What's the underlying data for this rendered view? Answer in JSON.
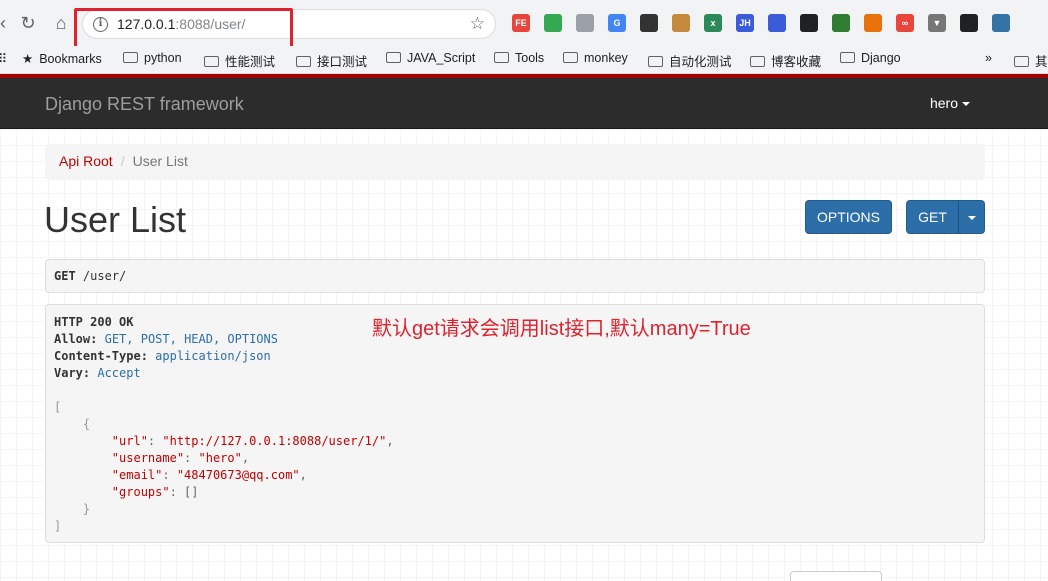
{
  "browser": {
    "url_host": "127.0.0.1",
    "url_rest": ":8088/user/",
    "extensions": [
      {
        "name": "fe-icon",
        "label": "FE",
        "color": "#e8453c"
      },
      {
        "name": "leaf-icon",
        "label": "",
        "color": "#34a853"
      },
      {
        "name": "recycle-icon",
        "label": "",
        "color": "#9aa0a6"
      },
      {
        "name": "translate-icon",
        "label": "G",
        "color": "#4285f4"
      },
      {
        "name": "chart-icon",
        "label": "",
        "color": "#333333"
      },
      {
        "name": "cookie-icon",
        "label": "",
        "color": "#c58a3e"
      },
      {
        "name": "xpath-icon",
        "label": "x",
        "color": "#2c8a5a"
      },
      {
        "name": "jh-icon",
        "label": "JH",
        "color": "#3b5bdb"
      },
      {
        "name": "grid-icon",
        "label": "",
        "color": "#3b5bdb"
      },
      {
        "name": "qr-icon",
        "label": "",
        "color": "#202124"
      },
      {
        "name": "globe-icon",
        "label": "",
        "color": "#2e7d32"
      },
      {
        "name": "mascot-icon",
        "label": "",
        "color": "#e8710a"
      },
      {
        "name": "infinity-icon",
        "label": "∞",
        "color": "#e8453c"
      },
      {
        "name": "vue-icon",
        "label": "▼",
        "color": "#777777"
      },
      {
        "name": "chat-icon",
        "label": "",
        "color": "#202124"
      },
      {
        "name": "python-icon",
        "label": "",
        "color": "#3572a5"
      }
    ]
  },
  "bookmarks": [
    {
      "label": "Bookmarks",
      "icon": "star-icon"
    },
    {
      "label": "python"
    },
    {
      "label": "性能测试"
    },
    {
      "label": "接口测试"
    },
    {
      "label": "JAVA_Script"
    },
    {
      "label": "Tools"
    },
    {
      "label": "monkey"
    },
    {
      "label": "自动化测试"
    },
    {
      "label": "博客收藏"
    },
    {
      "label": "Django"
    }
  ],
  "bookmarks_more": "»",
  "bookmarks_overflow": "其",
  "navbar": {
    "brand": "Django REST framework",
    "user": "hero"
  },
  "breadcrumb": {
    "root": "Api Root",
    "current": "User List"
  },
  "page_title": "User List",
  "buttons": {
    "options": "OPTIONS",
    "get": "GET"
  },
  "request": {
    "method": "GET",
    "path": "/user/"
  },
  "response": {
    "status": "HTTP 200 OK",
    "allow_key": "Allow:",
    "allow_val": "GET, POST, HEAD, OPTIONS",
    "ctype_key": "Content-Type:",
    "ctype_val": "application/json",
    "vary_key": "Vary:",
    "vary_val": "Accept",
    "body": {
      "url": "http://127.0.0.1:8088/user/1/",
      "username": "hero",
      "email": "48470673@qq.com",
      "groups": "[]"
    }
  },
  "annotation": "默认get请求会调用list接口,默认many=True"
}
